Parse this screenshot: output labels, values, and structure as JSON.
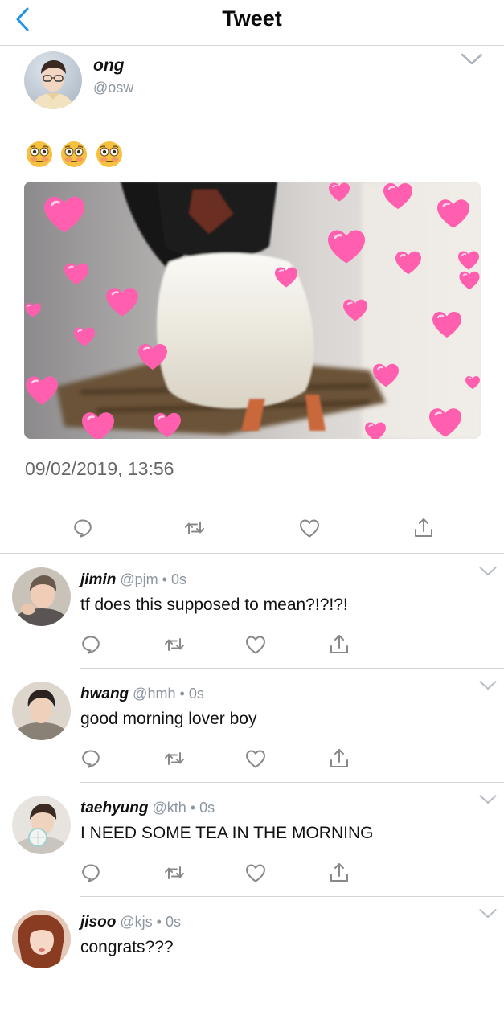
{
  "header": {
    "title": "Tweet",
    "back_icon": "chevron-left-icon",
    "accent": "#1e93e8"
  },
  "main_tweet": {
    "display_name": "ong",
    "handle": "@osw",
    "emoji_text": "😳😳😳",
    "timestamp": "09/02/2019, 13:56",
    "actions": [
      "reply-icon",
      "retweet-icon",
      "like-icon",
      "share-icon"
    ]
  },
  "replies": [
    {
      "name": "jimin",
      "handle": "@pjm",
      "time": "0s",
      "text": "tf does this supposed to mean?!?!?!"
    },
    {
      "name": "hwang",
      "handle": "@hmh",
      "time": "0s",
      "text": "good morning lover boy"
    },
    {
      "name": "taehyung",
      "handle": "@kth",
      "time": "0s",
      "text": "I NEED SOME TEA IN THE MORNING"
    },
    {
      "name": "jisoo",
      "handle": "@kjs",
      "time": "0s",
      "text": "congrats???"
    }
  ],
  "meta_separator": "•"
}
